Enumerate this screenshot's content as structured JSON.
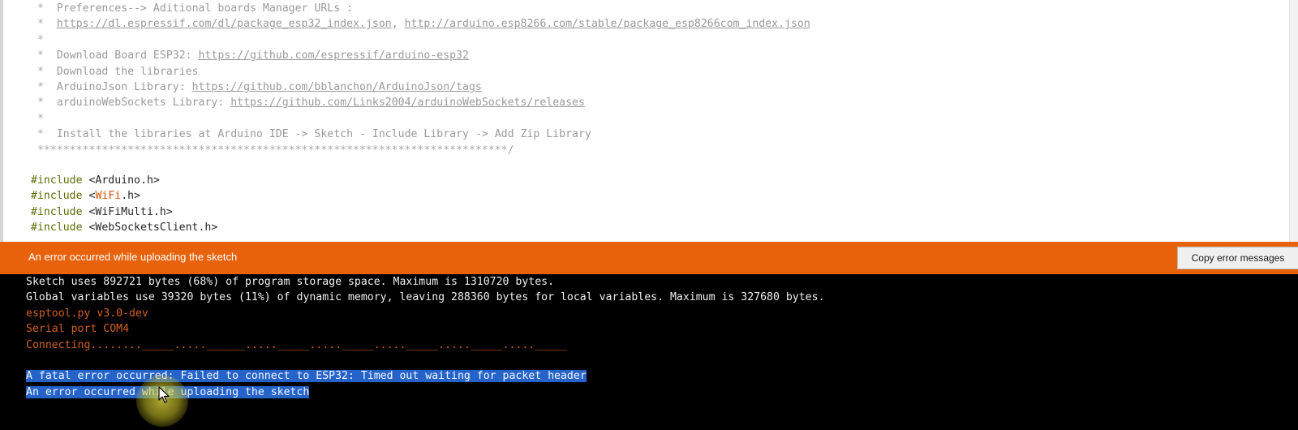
{
  "editor": {
    "comment_lines": [
      {
        "star": "*",
        "text": "Preferences--> Aditional boards Manager URLs :",
        "links": []
      },
      {
        "star": "*",
        "text": "",
        "links": [
          "https://dl.espressif.com/dl/package_esp32_index.json",
          "http://arduino.esp8266.com/stable/package_esp8266com_index.json"
        ],
        "separator": ", "
      },
      {
        "star": "*",
        "text": "",
        "links": []
      },
      {
        "star": "*",
        "text": "Download Board ESP32: ",
        "links": [
          "https://github.com/espressif/arduino-esp32"
        ]
      },
      {
        "star": "*",
        "text": "Download the libraries",
        "links": []
      },
      {
        "star": "*",
        "text": "ArduinoJson Library: ",
        "links": [
          "https://github.com/bblanchon/ArduinoJson/tags"
        ]
      },
      {
        "star": "*",
        "text": "arduinoWebSockets Library: ",
        "links": [
          "https://github.com/Links2004/arduinoWebSockets/releases"
        ]
      },
      {
        "star": "*",
        "text": "",
        "links": []
      },
      {
        "star": "*",
        "text": "Install the libraries at Arduino IDE -> Sketch - Include Library -> Add Zip Library",
        "links": []
      }
    ],
    "comment_end": "*************************************************************************/",
    "includes": [
      {
        "directive": "#include",
        "lib": "<Arduino.h>"
      },
      {
        "directive": "#include",
        "lib": "<WiFi.h>"
      },
      {
        "directive": "#include",
        "lib": "<WiFiMulti.h>"
      },
      {
        "directive": "#include",
        "lib": "<WebSocketsClient.h>"
      }
    ]
  },
  "error_bar": {
    "message": "An error occurred while uploading the sketch",
    "copy_button_label": "Copy error messages",
    "color": "#e8620c"
  },
  "console": {
    "lines": [
      {
        "text": "Sketch uses 892721 bytes (68%) of program storage space. Maximum is 1310720 bytes.",
        "style": "white"
      },
      {
        "text": "Global variables use 39320 bytes (11%) of dynamic memory, leaving 288360 bytes for local variables. Maximum is 327680 bytes.",
        "style": "white"
      },
      {
        "text": "esptool.py v3.0-dev",
        "style": "red"
      },
      {
        "text": "Serial port COM4",
        "style": "red"
      },
      {
        "text": "Connecting........_____.....______....._____....._____....._____....._____....._____",
        "style": "red"
      },
      {
        "text": "",
        "style": "red"
      },
      {
        "text": "A fatal error occurred: Failed to connect to ESP32: Timed out waiting for packet header",
        "style": "highlight"
      },
      {
        "text": "An error occurred while uploading the sketch",
        "style": "highlight"
      }
    ]
  }
}
